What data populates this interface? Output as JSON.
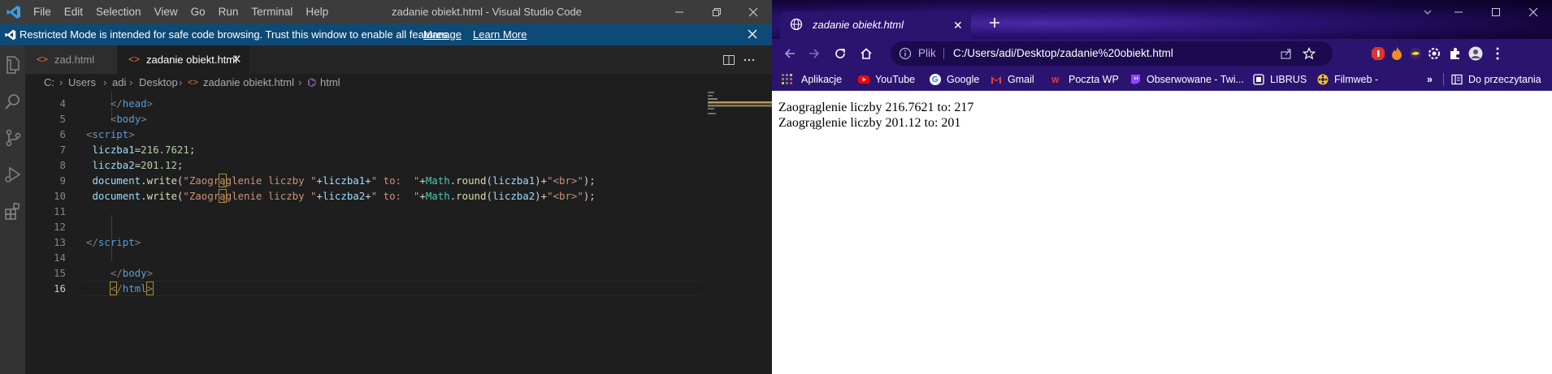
{
  "vscode": {
    "menu": [
      "File",
      "Edit",
      "Selection",
      "View",
      "Go",
      "Run",
      "Terminal",
      "Help"
    ],
    "window_title": "zadanie obiekt.html - Visual Studio Code",
    "notice": {
      "text": "Restricted Mode is intended for safe code browsing. Trust this window to enable all features.",
      "manage": "Manage",
      "learn_more": "Learn More"
    },
    "tabs": [
      {
        "label": "zad.html",
        "active": false
      },
      {
        "label": "zadanie obiekt.html",
        "active": true
      }
    ],
    "breadcrumb": [
      "C:",
      "Users",
      "adi",
      "Desktop",
      "zadanie obiekt.html",
      "html"
    ],
    "code": [
      {
        "n": "4",
        "tokens": [
          [
            "t-tag",
            "    </"
          ],
          [
            "t-name",
            "head"
          ],
          [
            "t-tag",
            ">"
          ]
        ]
      },
      {
        "n": "5",
        "tokens": [
          [
            "t-tag",
            "    <"
          ],
          [
            "t-name",
            "body"
          ],
          [
            "t-tag",
            ">"
          ]
        ]
      },
      {
        "n": "6",
        "tokens": [
          [
            "t-tag",
            "<"
          ],
          [
            "t-name",
            "script"
          ],
          [
            "t-tag",
            ">"
          ]
        ]
      },
      {
        "n": "7",
        "tokens": [
          [
            "t-var",
            " liczba1"
          ],
          [
            "t-op",
            "="
          ],
          [
            "t-num",
            "216.7621"
          ],
          [
            "t-op",
            ";"
          ]
        ]
      },
      {
        "n": "8",
        "tokens": [
          [
            "t-var",
            " liczba2"
          ],
          [
            "t-op",
            "="
          ],
          [
            "t-num",
            "201.12"
          ],
          [
            "t-op",
            ";"
          ]
        ]
      },
      {
        "n": "9",
        "tokens": [
          [
            "t-var",
            " document"
          ],
          [
            "t-op",
            "."
          ],
          [
            "t-fn",
            "write"
          ],
          [
            "t-op",
            "("
          ],
          [
            "t-str",
            "\"Zaogr"
          ],
          [
            "t-str hl-box",
            "ą"
          ],
          [
            "t-str",
            "glenie liczby \""
          ],
          [
            "t-op",
            "+"
          ],
          [
            "t-var",
            "liczba1"
          ],
          [
            "t-op",
            "+"
          ],
          [
            "t-str",
            "\" to:  \""
          ],
          [
            "t-op",
            "+"
          ],
          [
            "t-cls",
            "Math"
          ],
          [
            "t-op",
            "."
          ],
          [
            "t-fn",
            "round"
          ],
          [
            "t-op",
            "("
          ],
          [
            "t-var",
            "liczba1"
          ],
          [
            "t-op",
            ")+"
          ],
          [
            "t-str",
            "\"<br>\""
          ],
          [
            "t-op",
            ");"
          ]
        ]
      },
      {
        "n": "10",
        "tokens": [
          [
            "t-var",
            " document"
          ],
          [
            "t-op",
            "."
          ],
          [
            "t-fn",
            "write"
          ],
          [
            "t-op",
            "("
          ],
          [
            "t-str",
            "\"Zaogr"
          ],
          [
            "t-str hl-box",
            "ą"
          ],
          [
            "t-str",
            "glenie liczby \""
          ],
          [
            "t-op",
            "+"
          ],
          [
            "t-var",
            "liczba2"
          ],
          [
            "t-op",
            "+"
          ],
          [
            "t-str",
            "\" to:  \""
          ],
          [
            "t-op",
            "+"
          ],
          [
            "t-cls",
            "Math"
          ],
          [
            "t-op",
            "."
          ],
          [
            "t-fn",
            "round"
          ],
          [
            "t-op",
            "("
          ],
          [
            "t-var",
            "liczba2"
          ],
          [
            "t-op",
            ")+"
          ],
          [
            "t-str",
            "\"<br>\""
          ],
          [
            "t-op",
            ");"
          ]
        ]
      },
      {
        "n": "11",
        "tokens": []
      },
      {
        "n": "12",
        "tokens": []
      },
      {
        "n": "13",
        "tokens": [
          [
            "t-tag",
            "</"
          ],
          [
            "t-name",
            "script"
          ],
          [
            "t-tag",
            ">"
          ]
        ]
      },
      {
        "n": "14",
        "tokens": []
      },
      {
        "n": "15",
        "tokens": [
          [
            "t-tag",
            "    </"
          ],
          [
            "t-name",
            "body"
          ],
          [
            "t-tag",
            ">"
          ]
        ]
      },
      {
        "n": "16",
        "tokens": [
          [
            "t-tag",
            "    "
          ],
          [
            "t-tag hl-box",
            "<"
          ],
          [
            "t-tag",
            "/"
          ],
          [
            "t-name",
            "html"
          ],
          [
            "t-tag hl-box",
            ">"
          ]
        ]
      }
    ],
    "current_line": "16"
  },
  "chrome": {
    "tab_title": "zadanie obiekt.html",
    "omnibox": {
      "scheme_label": "Plik",
      "url": "C:/Users/adi/Desktop/zadanie%20obiekt.html"
    },
    "bookmarks": [
      "Aplikacje",
      "YouTube",
      "Google",
      "Gmail",
      "Poczta WP",
      "Obserwowane - Twi...",
      "LIBRUS",
      "Filmweb -"
    ],
    "reading_list": "Do przeczytania",
    "page_lines": [
      "Zaogrąglenie liczby 216.7621 to: 217",
      "Zaogrąglenie liczby 201.12 to: 201"
    ]
  },
  "colors": {
    "vscode_accent": "#0e4a78",
    "chrome_theme": "#2a1470"
  }
}
